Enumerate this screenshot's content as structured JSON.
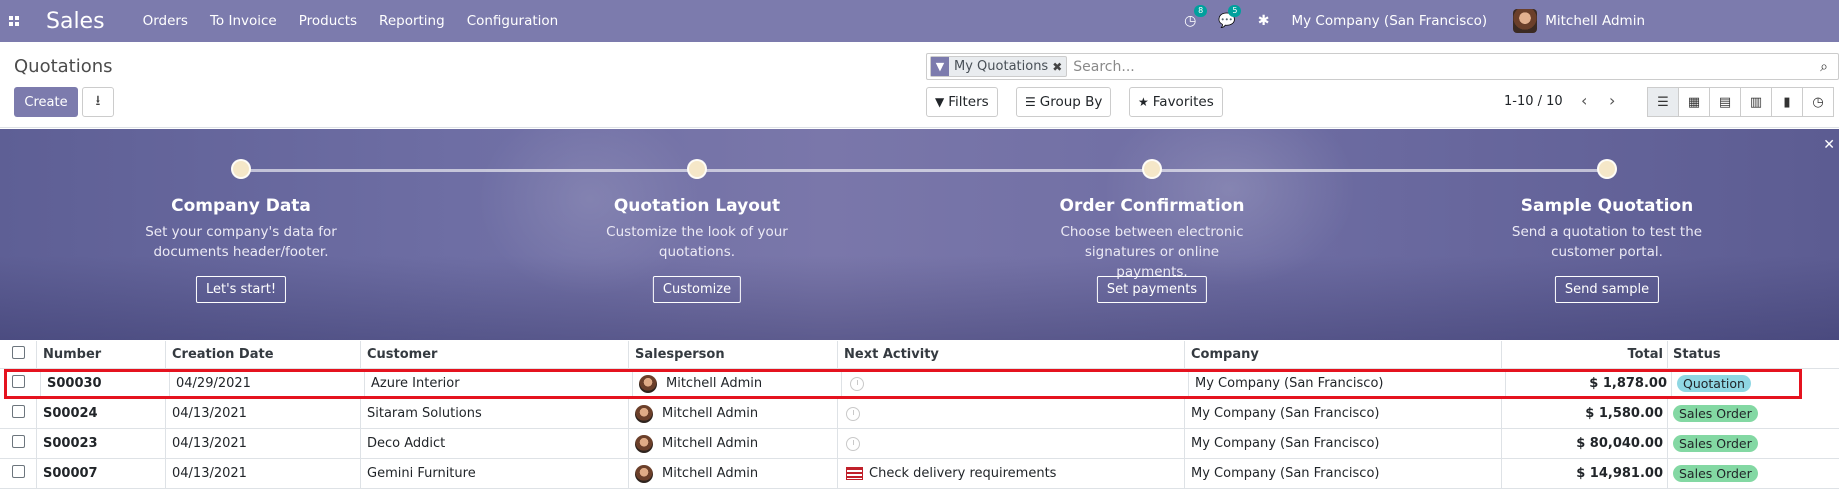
{
  "navbar": {
    "brand": "Sales",
    "menu": [
      "Orders",
      "To Invoice",
      "Products",
      "Reporting",
      "Configuration"
    ],
    "activity_count": "8",
    "message_count": "5",
    "company": "My Company (San Francisco)",
    "user": "Mitchell Admin"
  },
  "control_panel": {
    "breadcrumb": "Quotations",
    "create_label": "Create",
    "facet_label": "My Quotations",
    "search_placeholder": "Search...",
    "filters_label": "Filters",
    "groupby_label": "Group By",
    "favorites_label": "Favorites",
    "pager": "1-10 / 10"
  },
  "onboarding": {
    "steps": [
      {
        "title": "Company Data",
        "desc": "Set your company's data for documents header/footer.",
        "button": "Let's start!"
      },
      {
        "title": "Quotation Layout",
        "desc": "Customize the look of your quotations.",
        "button": "Customize"
      },
      {
        "title": "Order Confirmation",
        "desc": "Choose between electronic signatures or online payments.",
        "button": "Set payments"
      },
      {
        "title": "Sample Quotation",
        "desc": "Send a quotation to test the customer portal.",
        "button": "Send sample"
      }
    ]
  },
  "table": {
    "headers": {
      "number": "Number",
      "date": "Creation Date",
      "customer": "Customer",
      "salesperson": "Salesperson",
      "activity": "Next Activity",
      "company": "Company",
      "total": "Total",
      "status": "Status"
    },
    "rows": [
      {
        "number": "S00030",
        "date": "04/29/2021",
        "customer": "Azure Interior",
        "salesperson": "Mitchell Admin",
        "activity": "",
        "company": "My Company (San Francisco)",
        "total": "$ 1,878.00",
        "status": "Quotation"
      },
      {
        "number": "S00024",
        "date": "04/13/2021",
        "customer": "Sitaram Solutions",
        "salesperson": "Mitchell Admin",
        "activity": "",
        "company": "My Company (San Francisco)",
        "total": "$ 1,580.00",
        "status": "Sales Order"
      },
      {
        "number": "S00023",
        "date": "04/13/2021",
        "customer": "Deco Addict",
        "salesperson": "Mitchell Admin",
        "activity": "",
        "company": "My Company (San Francisco)",
        "total": "$ 80,040.00",
        "status": "Sales Order"
      },
      {
        "number": "S00007",
        "date": "04/13/2021",
        "customer": "Gemini Furniture",
        "salesperson": "Mitchell Admin",
        "activity": "Check delivery requirements",
        "company": "My Company (San Francisco)",
        "total": "$ 14,981.00",
        "status": "Sales Order"
      }
    ]
  }
}
